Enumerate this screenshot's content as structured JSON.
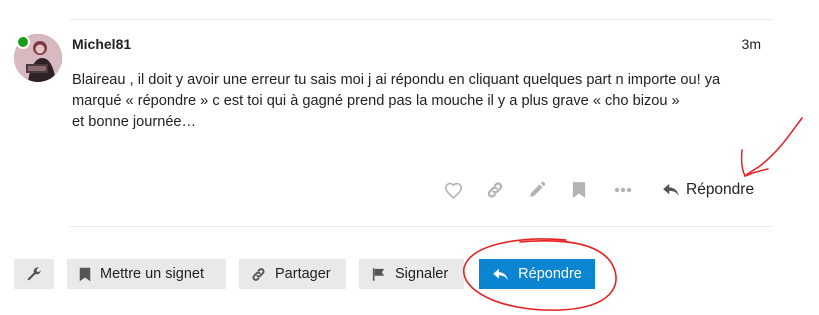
{
  "post": {
    "username": "Michel81",
    "time": "3m",
    "body": [
      "Blaireau , il doit y avoir une erreur tu sais moi j ai répondu en cliquant quelques part n importe ou! ya marqué « répondre » c est toi qui à gagné prend pas la mouche il y a plus grave « cho bizou »",
      "et bonne journée…"
    ],
    "reply_label": "Répondre",
    "action_icons": [
      "heart-icon",
      "link-icon",
      "pencil-icon",
      "bookmark-icon",
      "ellipsis-icon",
      "reply-icon"
    ]
  },
  "footer": {
    "admin_icon": "wrench-icon",
    "bookmark_label": "Mettre un signet",
    "share_label": "Partager",
    "flag_label": "Signaler",
    "reply_label": "Répondre"
  },
  "colors": {
    "accent": "#0a85d1",
    "online": "#1a9e1a",
    "annotation": "#e8201f",
    "muted_icon": "#b3b3b3",
    "button_bg": "#e9e9e9"
  }
}
